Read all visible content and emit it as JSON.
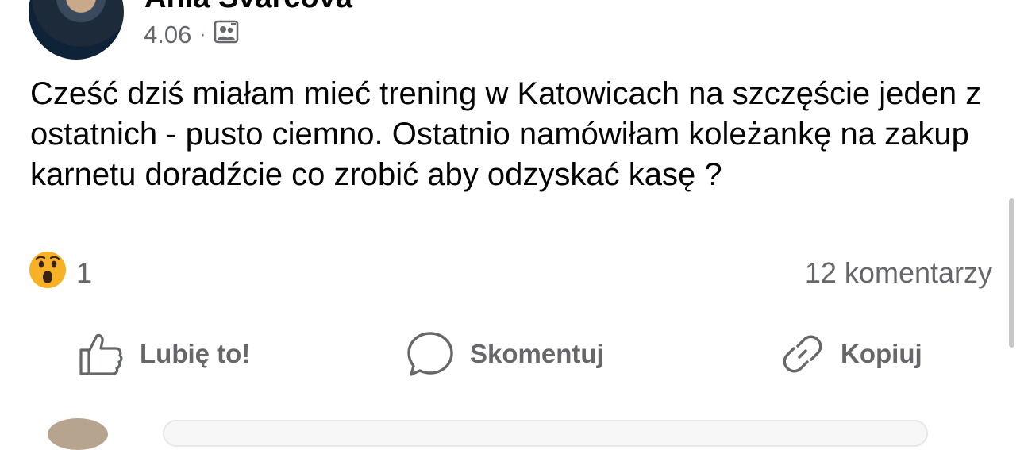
{
  "post": {
    "author": "Ania Svarcova",
    "date": "4.06",
    "separator": "·",
    "audience_icon": "friends-group-icon",
    "text": "Cześć dziś miałam mieć trening w Katowicach na szczęście jeden z ostatnich - pusto ciemno. Ostatnio namówiłam koleżankę na zakup karnetu doradźcie co zrobić aby odzyskać kasę ?"
  },
  "reactions": {
    "emoji": "😮",
    "emoji_icon": "wow-reaction-icon",
    "count": "1",
    "comments": "12 komentarzy"
  },
  "actions": {
    "like_label": "Lubię to!",
    "comment_label": "Skomentuj",
    "copy_label": "Kopiuj"
  },
  "colors": {
    "text": "#050505",
    "secondary": "#65676b",
    "background": "#ffffff"
  }
}
